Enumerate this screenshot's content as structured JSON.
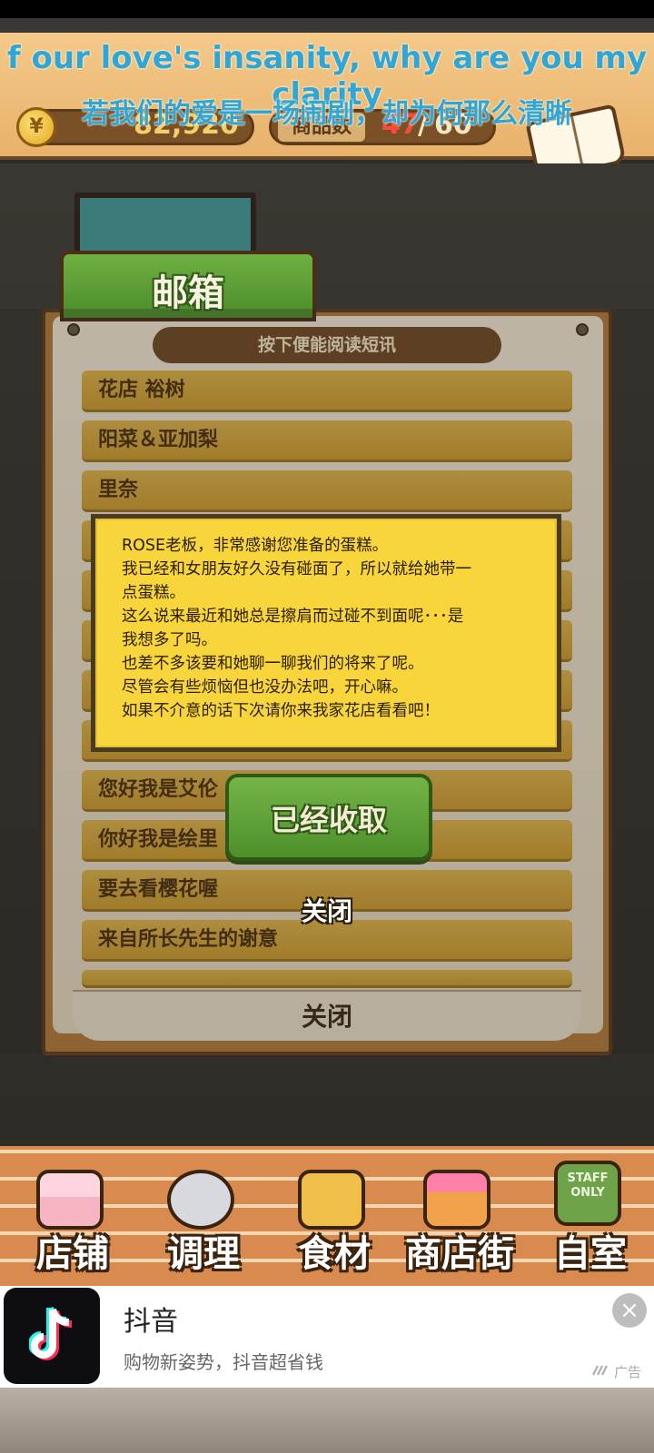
{
  "hud": {
    "money": "82,920",
    "goods_label": "商品数",
    "goods_count": "47",
    "goods_separator": "/",
    "goods_total": "60",
    "recipe_label": "食谱",
    "coin_symbol": "¥"
  },
  "lyrics": {
    "english": "f our love's insanity, why are you my clarity",
    "chinese": "若我们的爱是一场闹剧，却为何那么清晰"
  },
  "mailbox": {
    "title": "邮箱",
    "hint": "按下便能阅读短讯",
    "items": [
      "花店 裕树",
      "阳菜＆亚加梨",
      "里奈",
      "",
      "",
      "",
      "",
      "",
      "您好我是艾伦",
      "你好我是绘里",
      "要去看樱花喔",
      "来自所长先生的谢意"
    ],
    "footer_close": "关闭"
  },
  "popup": {
    "lines": [
      "ROSE老板，非常感谢您准备的蛋糕。",
      "我已经和女朋友好久没有碰面了，所以就给她带一",
      "点蛋糕。",
      "这么说来最近和她总是擦肩而过碰不到面呢･･･是",
      "我想多了吗。",
      "也差不多该要和她聊一聊我们的将来了呢。",
      "尽管会有些烦恼但也没办法吧，开心嘛。",
      "如果不介意的话下次请你来我家花店看看吧！"
    ],
    "received_button": "已经收取",
    "close_label": "关闭"
  },
  "bottom_nav": {
    "items": [
      "店铺",
      "调理",
      "食材",
      "商店街",
      "自室"
    ],
    "staff_sign": "STAFF ONLY"
  },
  "ad": {
    "title": "抖音",
    "subtitle": "购物新姿势，抖音超省钱",
    "close_icon": "×",
    "mark": "广告"
  },
  "colors": {
    "lyric": "#2fa6d6",
    "popup_bg": "#f8d53a",
    "button_green": "#4e8f2b",
    "mail_item": "#c99a2e"
  }
}
